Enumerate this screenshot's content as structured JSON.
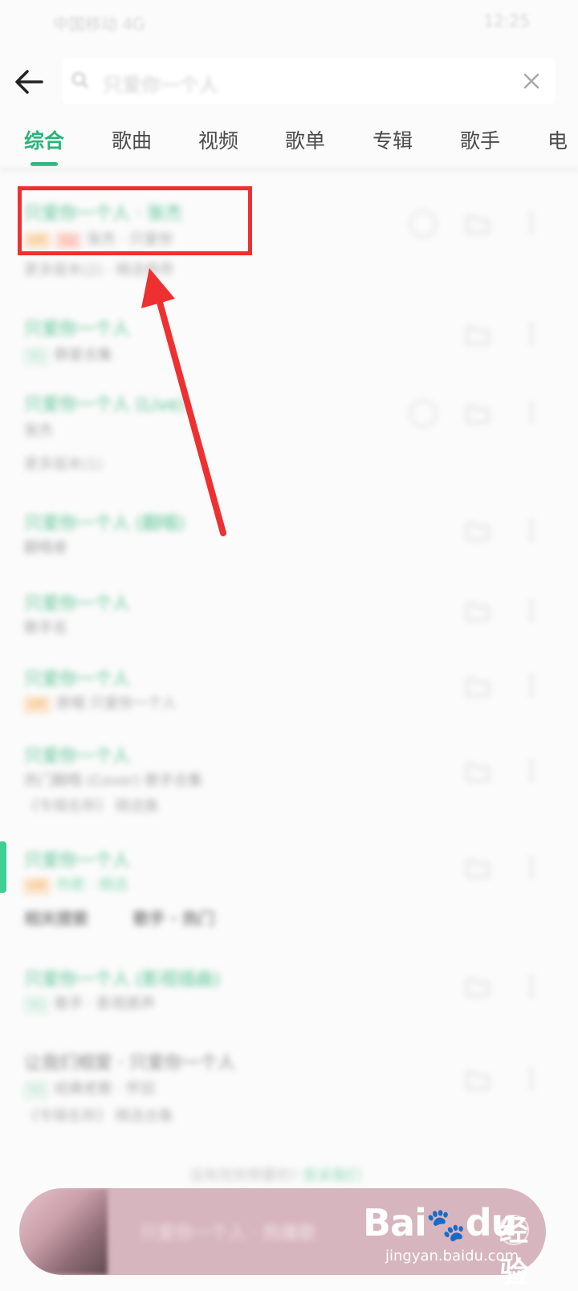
{
  "status_bar": {
    "left": "中国移动 4G",
    "right": "12:25"
  },
  "search": {
    "query": "只爱你一个人"
  },
  "tabs": [
    {
      "label": "综合"
    },
    {
      "label": "歌曲"
    },
    {
      "label": "视频"
    },
    {
      "label": "歌单"
    },
    {
      "label": "专辑"
    },
    {
      "label": "歌手"
    },
    {
      "label": "电"
    }
  ],
  "results": [
    {
      "title": "只爱你一个人 · 张杰",
      "sub": "张杰 · 只爱你",
      "extra": "更多版本(2) · 精选推荐"
    },
    {
      "title": "只爱你一个人",
      "sub": "群星合集"
    },
    {
      "title": "只爱你一个人 (Live)",
      "sub": "张杰",
      "extra": "更多版本(1)"
    },
    {
      "title": "只爱你一个人 (翻唱)",
      "sub": "翻唱者"
    },
    {
      "title": "只爱你一个人",
      "sub": "歌手名"
    },
    {
      "title": "只爱你一个人",
      "sub": "原唱 只爱你一个人"
    },
    {
      "title": "只爱你一个人",
      "sub": "热门翻唱 (Cover) 歌手合集",
      "extra": "《专辑名称》 精选集"
    },
    {
      "title": "只爱你一个人",
      "sub": "热歌 · 精选"
    },
    {
      "title": "只爱你一个人 (影视插曲)",
      "sub": "歌手 · 影视原声"
    },
    {
      "title": "让我们相爱 · 只爱你一个人",
      "sub": "经典老歌 · 怀旧",
      "extra": "《专辑名称》 精选合集"
    }
  ],
  "section_heading": {
    "left": "相关搜索",
    "right": "歌手 · 热门"
  },
  "footer": {
    "hint": "没有找到想要的?",
    "link": "告诉我们"
  },
  "player": {
    "title": "只爱你一个人 · 热播歌"
  },
  "watermark": {
    "brand": "Bai",
    "brand2": "du",
    "cn": "经验",
    "url": "jingyan.baidu.com"
  },
  "colors": {
    "accent": "#29b37a",
    "highlight": "#ee3030"
  }
}
